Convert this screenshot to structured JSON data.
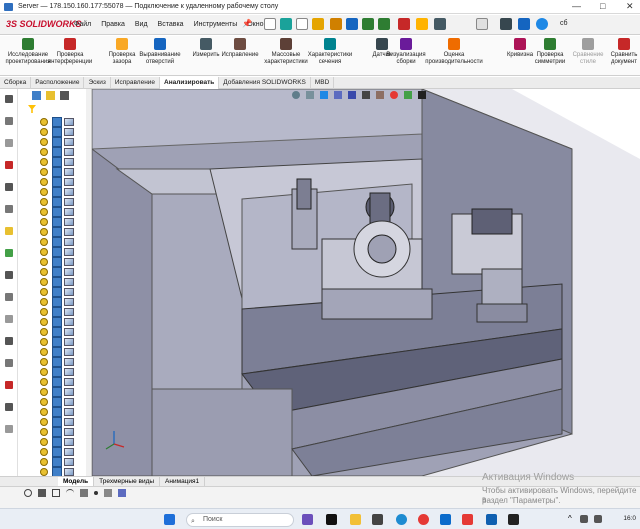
{
  "rdp_window": {
    "title": "Server — 178.150.160.177:55078 — Подключение к удаленному рабочему столу",
    "controls": {
      "minimize": "—",
      "maximize": "□",
      "close": "✕"
    }
  },
  "solidworks": {
    "logo": "SOLIDWORKS",
    "menu": [
      "Файл",
      "Правка",
      "Вид",
      "Вставка",
      "Инструменты",
      "Окно"
    ],
    "search_partial": "сб"
  },
  "ribbon": {
    "buttons": [
      {
        "label": "Исследование проектирования",
        "icon": "design-study-icon",
        "color": "#2e7d32"
      },
      {
        "label": "Проверка интерференции",
        "icon": "interference-icon",
        "color": "#c62828"
      },
      {
        "label": "Проверка зазора",
        "icon": "clearance-icon",
        "color": "#f9a825"
      },
      {
        "label": "Выравнивание отверстий",
        "icon": "hole-align-icon",
        "color": "#1565c0"
      },
      {
        "label": "Измерить",
        "icon": "measure-icon",
        "color": "#455a64"
      },
      {
        "label": "Исправление",
        "icon": "repair-icon",
        "color": "#6d4c41"
      },
      {
        "label": "Массовые характеристики",
        "icon": "mass-props-icon",
        "color": "#5d4037"
      },
      {
        "label": "Характеристики сечения",
        "icon": "section-props-icon",
        "color": "#00838f"
      },
      {
        "label": "Датчик",
        "icon": "sensor-icon",
        "color": "#37474f"
      },
      {
        "label": "Визуализация сборки",
        "icon": "assembly-viz-icon",
        "color": "#6a1b9a"
      },
      {
        "label": "Оценка производительности",
        "icon": "performance-icon",
        "color": "#ef6c00"
      },
      {
        "label": "Кривизна",
        "icon": "curvature-icon",
        "color": "#ad1457"
      },
      {
        "label": "Проверка симметрии",
        "icon": "symmetry-icon",
        "color": "#2e7d32"
      },
      {
        "label": "Сравнение стиле",
        "icon": "compare-style-icon",
        "color": "#9e9e9e",
        "disabled": true
      },
      {
        "label": "Сравнить документ",
        "icon": "compare-doc-icon",
        "color": "#c62828"
      }
    ]
  },
  "command_tabs": [
    "Сборка",
    "Расположение",
    "Эскиз",
    "Исправление",
    "Анализировать",
    "Добавления SOLIDWORKS",
    "MBD"
  ],
  "active_command_tab": "Анализировать",
  "bottom_tabs": [
    "Модель",
    "Трехмерные виды",
    "Анимация1"
  ],
  "active_bottom_tab": "Модель",
  "watermark": {
    "line1": "Активация Windows",
    "line2": "Чтобы активировать Windows, перейдите в",
    "line3": "раздел \"Параметры\"."
  },
  "taskbar": {
    "search_placeholder": "Поиск",
    "clock": "16:0"
  },
  "colors": {
    "accent": "#c8102e",
    "machine_body": "#a4a6ba",
    "machine_dark": "#6f7188"
  }
}
